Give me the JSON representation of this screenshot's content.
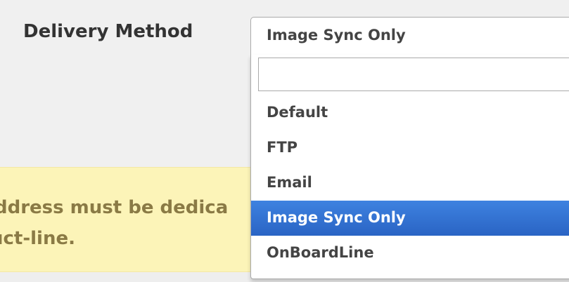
{
  "form": {
    "delivery_method_label": "Delivery Method"
  },
  "notice": {
    "line1": "ddress must be dedica",
    "line2": "uct-line."
  },
  "select": {
    "current_value": "Image Sync Only",
    "search_value": "",
    "search_placeholder": "",
    "options": [
      {
        "label": "Default"
      },
      {
        "label": "FTP"
      },
      {
        "label": "Email"
      },
      {
        "label": "Image Sync Only",
        "selected": true
      },
      {
        "label": "OnBoardLine"
      }
    ]
  },
  "colors": {
    "highlight": "#3875d7",
    "notice_background": "#fcf4b8",
    "panel_background": "#f0f0f0"
  }
}
